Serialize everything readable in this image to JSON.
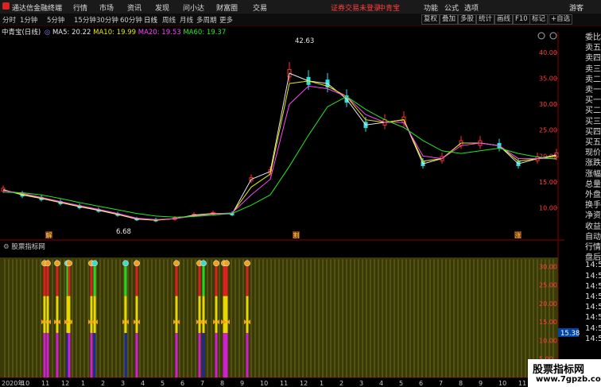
{
  "app": {
    "title": "通达信金融终端",
    "menus": [
      "行情",
      "市场",
      "资讯",
      "发现",
      "问小达",
      "财富圈",
      "交易"
    ],
    "login_warning": "证券交易未登录",
    "stock_name": "中青宝",
    "right_menus": [
      "功能",
      "公式",
      "选项",
      "游客"
    ]
  },
  "toolbar": {
    "periods": [
      "分时",
      "1分钟",
      "5分钟",
      "15分钟",
      "30分钟",
      "60分钟",
      "日线",
      "周线",
      "月线",
      "多周期",
      "更多"
    ],
    "active_period": "日线",
    "tools": [
      "复权",
      "叠加",
      "多股",
      "统计",
      "画线",
      "F10",
      "标记",
      "+自选"
    ]
  },
  "main_chart": {
    "stock": "中青宝(日线)",
    "ma": [
      {
        "name": "MA5",
        "value": "20.22",
        "color": "#e8e8e8"
      },
      {
        "name": "MA10",
        "value": "19.99",
        "color": "#e8e800"
      },
      {
        "name": "MA20",
        "value": "19.53",
        "color": "#ff44ff"
      },
      {
        "name": "MA60",
        "value": "19.37",
        "color": "#22e822"
      }
    ],
    "high_label": "42.63",
    "low_label": "6.68",
    "badges": [
      "解",
      "割",
      "涨"
    ],
    "y_ticks": [
      "40.00",
      "35.00",
      "30.00",
      "25.00",
      "20.00",
      "15.00",
      "10.00"
    ]
  },
  "sub_chart": {
    "indicator": "股票指标网",
    "y_ticks": [
      "30.00",
      "25.00",
      "20.00",
      "15.00",
      "10.00",
      "5.00"
    ],
    "current_value": "15.38"
  },
  "x_axis": [
    "2020年",
    "10",
    "11",
    "12",
    "1",
    "2",
    "3",
    "4",
    "5",
    "6",
    "7",
    "8",
    "9",
    "10",
    "11",
    "12",
    "1",
    "2",
    "3",
    "4",
    "5",
    "6",
    "7",
    "8",
    "9",
    "10",
    "11",
    "12"
  ],
  "sidebar": [
    "委比",
    "卖五",
    "卖四",
    "卖三",
    "卖二",
    "卖一",
    "买一",
    "买二",
    "买三",
    "买四",
    "买五",
    "现价",
    "涨跌",
    "涨幅",
    "总量",
    "外盘",
    "换手",
    "净资",
    "收益",
    "自动",
    "行情",
    "盘后",
    "14:50",
    "14:50",
    "14:50",
    "14:50",
    "14:50",
    "14:50",
    "14:50",
    "14:50"
  ],
  "watermark": {
    "title": "股票指标网",
    "url": "www.7gpzb.com"
  },
  "chart_data": {
    "type": "line",
    "x": [
      0,
      6,
      12,
      18,
      24,
      30,
      36,
      42,
      48,
      54,
      60,
      66,
      72,
      78,
      84,
      90,
      96,
      102,
      108,
      114,
      120,
      126,
      132,
      138,
      144,
      150,
      156,
      162,
      168,
      174
    ],
    "series": [
      {
        "name": "MA5",
        "values": [
          13.5,
          12.5,
          11.8,
          11.0,
          10.2,
          9.5,
          8.7,
          7.8,
          7.6,
          7.9,
          8.6,
          8.9,
          8.8,
          15.5,
          17.0,
          36.0,
          34.5,
          34.0,
          31.0,
          26.0,
          26.5,
          27.0,
          18.5,
          19.5,
          22.5,
          22.5,
          22.0,
          18.5,
          19.5,
          20.2
        ]
      },
      {
        "name": "MA10",
        "values": [
          13.4,
          12.6,
          11.9,
          11.1,
          10.3,
          9.6,
          8.8,
          7.9,
          7.6,
          7.9,
          8.5,
          8.9,
          8.9,
          14.0,
          16.5,
          34.0,
          34.5,
          33.5,
          31.5,
          27.0,
          26.5,
          27.0,
          19.0,
          19.5,
          22.5,
          22.5,
          22.0,
          19.0,
          19.5,
          20.0
        ]
      },
      {
        "name": "MA20",
        "values": [
          13.3,
          12.8,
          12.0,
          11.2,
          10.4,
          9.7,
          8.9,
          8.0,
          7.7,
          7.9,
          8.4,
          8.8,
          9.0,
          12.5,
          15.5,
          30.0,
          33.5,
          33.0,
          31.5,
          28.0,
          26.5,
          26.5,
          20.0,
          19.5,
          22.0,
          22.5,
          22.0,
          19.5,
          19.5,
          19.5
        ]
      },
      {
        "name": "MA60",
        "values": [
          13.0,
          12.9,
          12.5,
          11.8,
          11.0,
          10.3,
          9.6,
          8.9,
          8.4,
          8.2,
          8.3,
          8.6,
          8.9,
          10.5,
          12.5,
          18.0,
          24.0,
          29.5,
          31.5,
          29.0,
          27.0,
          25.5,
          23.0,
          21.0,
          20.5,
          21.0,
          21.5,
          20.5,
          19.8,
          19.4
        ]
      }
    ],
    "ylim": [
      5,
      44
    ],
    "sub_chart": {
      "type": "bar",
      "ylim": [
        0,
        32
      ],
      "signals": [
        {
          "x": 56,
          "kind": "red"
        },
        {
          "x": 60,
          "kind": "red"
        },
        {
          "x": 72,
          "kind": "red"
        },
        {
          "x": 85,
          "kind": "green"
        },
        {
          "x": 87,
          "kind": "red"
        },
        {
          "x": 115,
          "kind": "red"
        },
        {
          "x": 119,
          "kind": "green"
        },
        {
          "x": 158,
          "kind": "green"
        },
        {
          "x": 172,
          "kind": "red"
        },
        {
          "x": 222,
          "kind": "red"
        },
        {
          "x": 251,
          "kind": "red"
        },
        {
          "x": 256,
          "kind": "green"
        },
        {
          "x": 272,
          "kind": "red"
        },
        {
          "x": 282,
          "kind": "red"
        },
        {
          "x": 285,
          "kind": "red"
        },
        {
          "x": 311,
          "kind": "red"
        }
      ]
    }
  }
}
